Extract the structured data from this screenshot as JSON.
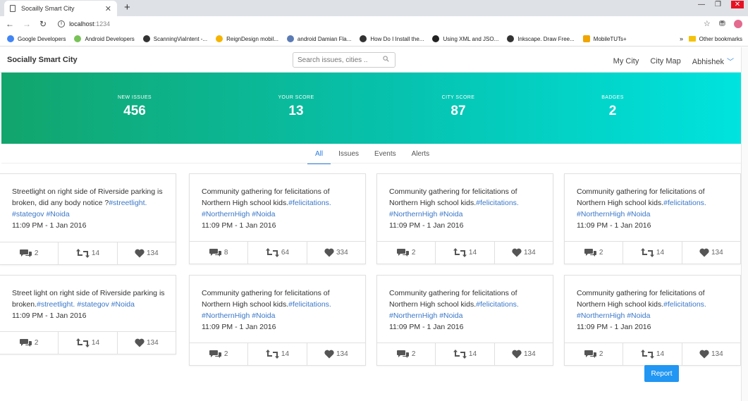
{
  "browser": {
    "tab_title": "Socailly Smart City",
    "tab_close": "✕",
    "new_tab": "+",
    "url_host": "localhost",
    "url_port": ":1234",
    "bookmarks": [
      {
        "label": "Google Developers",
        "color": "#4285f4"
      },
      {
        "label": "Android Developers",
        "color": "#78c257"
      },
      {
        "label": "ScanningViaIntent -...",
        "color": "#333333"
      },
      {
        "label": "ReignDesign mobil...",
        "color": "#f5b400"
      },
      {
        "label": "android Damian Fla...",
        "color": "#5b7bb5"
      },
      {
        "label": "How Do I Install the...",
        "color": "#333333"
      },
      {
        "label": "Using XML and JSO...",
        "color": "#222222"
      },
      {
        "label": "Inkscape. Draw Free...",
        "color": "#333333"
      },
      {
        "label": "MobileTUTs+",
        "color": "#f0a500"
      }
    ],
    "bookmarks_more": "»",
    "other_bookmarks": "Other bookmarks"
  },
  "navbar": {
    "brand": "Socially Smart City",
    "search_placeholder": "Search issues, cities ..",
    "links": [
      "My City",
      "City Map"
    ],
    "user": "Abhishek"
  },
  "stats": [
    {
      "label": "NEW ISSUES",
      "value": "456"
    },
    {
      "label": "YOUR SCORE",
      "value": "13"
    },
    {
      "label": "CITY SCORE",
      "value": "87"
    },
    {
      "label": "BADGES",
      "value": "2"
    }
  ],
  "filter_tabs": [
    {
      "label": "All",
      "active": true
    },
    {
      "label": "Issues",
      "active": false
    },
    {
      "label": "Events",
      "active": false
    },
    {
      "label": "Alerts",
      "active": false
    }
  ],
  "cards": [
    {
      "text": "Streetlight on right side of Riverside parking is broken, did any body notice ?",
      "tags": "#streetlight. #stategov #Noida",
      "time": "11:09 PM - 1 Jan 2016",
      "comments": "2",
      "reposts": "14",
      "likes": "134"
    },
    {
      "text": "Community gathering for felicitations of Northern High school kids.",
      "tags": "#felicitations. #NorthernHigh #Noida",
      "time": "11:09 PM - 1 Jan 2016",
      "comments": "8",
      "reposts": "64",
      "likes": "334"
    },
    {
      "text": "Community gathering for felicitations of Northern High school kids.",
      "tags": "#felicitations. #NorthernHigh #Noida",
      "time": "11:09 PM - 1 Jan 2016",
      "comments": "2",
      "reposts": "14",
      "likes": "134"
    },
    {
      "text": "Community gathering for felicitations of Northern High school kids.",
      "tags": "#felicitations. #NorthernHigh #Noida",
      "time": "11:09 PM - 1 Jan 2016",
      "comments": "2",
      "reposts": "14",
      "likes": "134"
    },
    {
      "text": "Street light on right side of Riverside parking is broken.",
      "tags": "#streetlight. #stategov #Noida",
      "time": "11:09 PM - 1 Jan 2016",
      "comments": "2",
      "reposts": "14",
      "likes": "134"
    },
    {
      "text": "Community gathering for felicitations of Northern High school kids.",
      "tags": "#felicitations. #NorthernHigh #Noida",
      "time": "11:09 PM - 1 Jan 2016",
      "comments": "2",
      "reposts": "14",
      "likes": "134"
    },
    {
      "text": "Community gathering for felicitations of Northern High school kids.",
      "tags": "#felicitations. #NorthernHigh #Noida",
      "time": "11:09 PM - 1 Jan 2016",
      "comments": "2",
      "reposts": "14",
      "likes": "134"
    },
    {
      "text": "Community gathering for felicitations of Northern High school kids.",
      "tags": "#felicitations. #NorthernHigh #Noida",
      "time": "11:09 PM - 1 Jan 2016",
      "comments": "2",
      "reposts": "14",
      "likes": "134"
    }
  ],
  "report_button": "Report",
  "colors": {
    "accent": "#2a7de1",
    "tag": "#3b78c8",
    "banner_start": "#12a56c",
    "banner_end": "#00e3de",
    "report": "#2196f3"
  }
}
